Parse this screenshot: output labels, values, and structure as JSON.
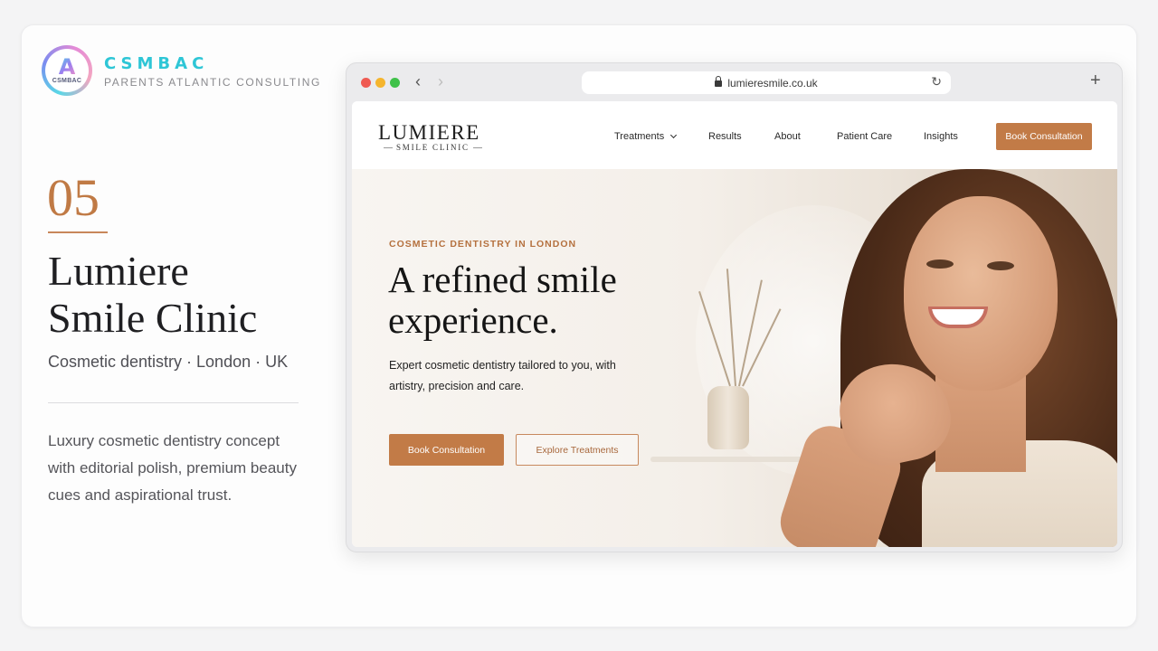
{
  "agency": {
    "logo_text": "CSMBAC",
    "logo_letter": "A",
    "name": "CSMBAC",
    "subtitle": "PARENTS ATLANTIC CONSULTING"
  },
  "project": {
    "number": "05",
    "title_line1": "Lumiere",
    "title_line2": "Smile Clinic",
    "subtitle": "Cosmetic dentistry · London · UK",
    "description": "Luxury cosmetic dentistry concept with editorial polish, premium beauty cues and aspirational trust."
  },
  "browser": {
    "url": "lumieresmile.co.uk",
    "back_icon": "‹",
    "forward_icon": "›",
    "reload_icon": "↻",
    "new_tab_icon": "+"
  },
  "site": {
    "logo": "LUMIERE",
    "logo_sub": "SMILE CLINIC",
    "nav": {
      "treatments": "Treatments",
      "results": "Results",
      "about": "About",
      "patient_care": "Patient Care",
      "insights": "Insights",
      "cta": "Book Consultation"
    },
    "hero": {
      "eyebrow": "COSMETIC DENTISTRY IN LONDON",
      "title_line1": "A refined smile",
      "title_line2": "experience.",
      "body": "Expert cosmetic dentistry tailored to you, with artistry, precision and care.",
      "primary_button": "Book Consultation",
      "secondary_button": "Explore Treatments"
    }
  },
  "colors": {
    "accent": "#c27b47",
    "agency_cyan": "#2ec6d6"
  }
}
